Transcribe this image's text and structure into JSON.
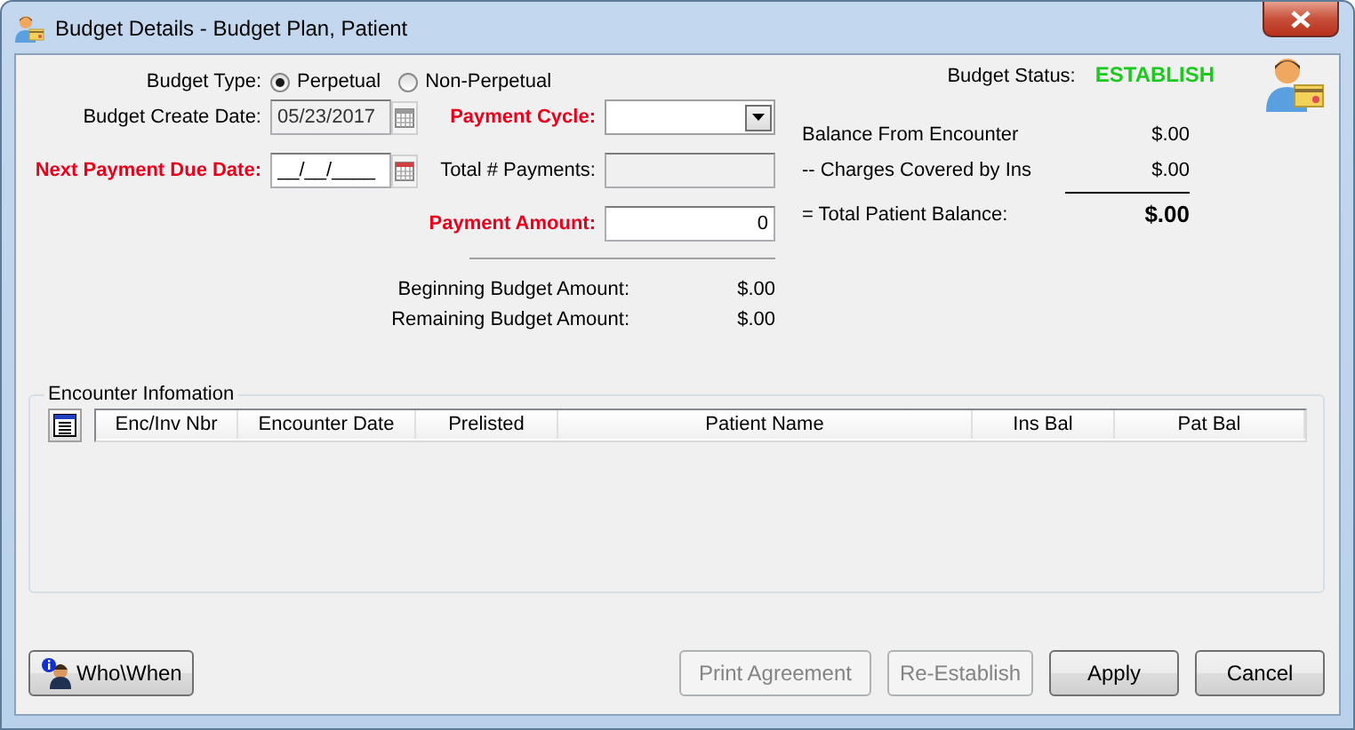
{
  "window": {
    "title": "Budget Details - Budget Plan, Patient"
  },
  "budget_type": {
    "label": "Budget Type:",
    "options": [
      {
        "label": "Perpetual",
        "selected": true
      },
      {
        "label": "Non-Perpetual",
        "selected": false
      }
    ]
  },
  "create_date": {
    "label": "Budget Create Date:",
    "value": "05/23/2017",
    "disabled": true,
    "required": false
  },
  "next_due_date": {
    "label": "Next Payment Due Date:",
    "value": "__/__/____",
    "disabled": false,
    "required": true
  },
  "payment_cycle": {
    "label": "Payment Cycle:",
    "required": true
  },
  "total_payments": {
    "label": "Total # Payments:",
    "disabled": true,
    "required": false
  },
  "payment_amount": {
    "label": "Payment Amount:",
    "value": "0",
    "required": true
  },
  "budget_amounts": [
    {
      "label": "Beginning Budget Amount:",
      "value": "$.00"
    },
    {
      "label": "Remaining Budget Amount:",
      "value": "$.00"
    }
  ],
  "status": {
    "label": "Budget Status:",
    "value": "ESTABLISH"
  },
  "balances": [
    {
      "label": "Balance From Encounter",
      "value": "$.00",
      "kind": "line"
    },
    {
      "label": "-- Charges Covered by Ins",
      "value": "$.00",
      "kind": "line"
    },
    {
      "label": "= Total Patient Balance:",
      "value": "$.00",
      "kind": "total"
    }
  ],
  "encounters": {
    "title": "Encounter Infomation",
    "columns": [
      "Enc/Inv Nbr",
      "Encounter Date",
      "Prelisted",
      "Patient Name",
      "Ins Bal",
      "Pat Bal"
    ]
  },
  "left_buttons": [
    {
      "label": "Who\\When",
      "kind": "info",
      "disabled": false
    }
  ],
  "right_buttons": [
    {
      "label": "Print Agreement",
      "kind": "plain",
      "disabled": true
    },
    {
      "label": "Re-Establish",
      "kind": "plain",
      "disabled": true
    },
    {
      "label": "Apply",
      "kind": "plain",
      "disabled": false
    },
    {
      "label": "Cancel",
      "kind": "plain",
      "disabled": false
    }
  ]
}
